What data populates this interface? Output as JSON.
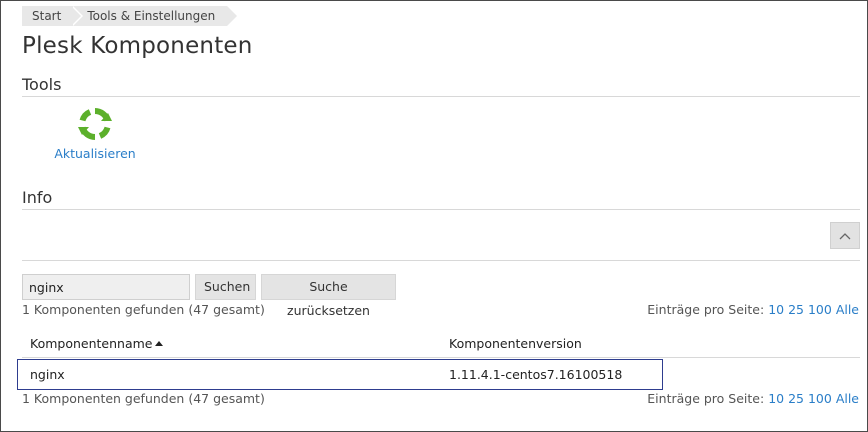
{
  "breadcrumb": {
    "items": [
      {
        "label": "Start"
      },
      {
        "label": "Tools & Einstellungen"
      }
    ]
  },
  "page": {
    "title": "Plesk Komponenten"
  },
  "tools_section": {
    "title": "Tools",
    "update_label": "Aktualisieren"
  },
  "info_section": {
    "title": "Info"
  },
  "search": {
    "value": "nginx",
    "search_label": "Suchen",
    "reset_label": "Suche zurücksetzen"
  },
  "results": {
    "summary": "1 Komponenten gefunden (47 gesamt)",
    "per_page_label": "Einträge pro Seite:",
    "per_page_options": [
      "10",
      "25",
      "100",
      "Alle"
    ]
  },
  "table": {
    "columns": {
      "name": "Komponentenname",
      "version": "Komponentenversion"
    },
    "rows": [
      {
        "name": "nginx",
        "version": "1.11.4.1-centos7.16100518"
      }
    ]
  },
  "colors": {
    "link": "#2a7ec8",
    "refresh_icon": "#5cb02b",
    "row_border": "#2e3d8f"
  }
}
